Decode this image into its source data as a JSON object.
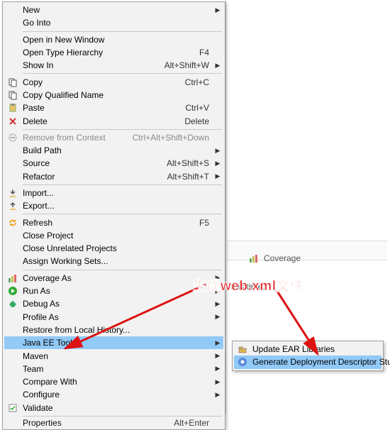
{
  "menu": {
    "items": [
      {
        "label": "New",
        "shortcut": "",
        "sub": true
      },
      {
        "label": "Go Into"
      },
      {
        "sep": true
      },
      {
        "label": "Open in New Window"
      },
      {
        "label": "Open Type Hierarchy",
        "shortcut": "F4"
      },
      {
        "label": "Show In",
        "shortcut": "Alt+Shift+W",
        "sub": true
      },
      {
        "sep": true
      },
      {
        "label": "Copy",
        "shortcut": "Ctrl+C",
        "icon": "copy"
      },
      {
        "label": "Copy Qualified Name",
        "icon": "copyq"
      },
      {
        "label": "Paste",
        "shortcut": "Ctrl+V",
        "icon": "paste"
      },
      {
        "label": "Delete",
        "shortcut": "Delete",
        "icon": "delete"
      },
      {
        "sep": true
      },
      {
        "label": "Remove from Context",
        "shortcut": "Ctrl+Alt+Shift+Down",
        "disabled": true,
        "icon": "remove"
      },
      {
        "label": "Build Path",
        "sub": true
      },
      {
        "label": "Source",
        "shortcut": "Alt+Shift+S",
        "sub": true
      },
      {
        "label": "Refactor",
        "shortcut": "Alt+Shift+T",
        "sub": true
      },
      {
        "sep": true
      },
      {
        "label": "Import...",
        "icon": "import"
      },
      {
        "label": "Export...",
        "icon": "export"
      },
      {
        "sep": true
      },
      {
        "label": "Refresh",
        "shortcut": "F5",
        "icon": "refresh"
      },
      {
        "label": "Close Project"
      },
      {
        "label": "Close Unrelated Projects"
      },
      {
        "label": "Assign Working Sets..."
      },
      {
        "sep": true
      },
      {
        "label": "Coverage As",
        "sub": true,
        "icon": "coverage"
      },
      {
        "label": "Run As",
        "sub": true,
        "icon": "run"
      },
      {
        "label": "Debug As",
        "sub": true,
        "icon": "debug"
      },
      {
        "label": "Profile As",
        "sub": true
      },
      {
        "label": "Restore from Local History..."
      },
      {
        "label": "Java EE Tools",
        "sub": true,
        "highlight": true
      },
      {
        "label": "Maven",
        "sub": true
      },
      {
        "label": "Team",
        "sub": true
      },
      {
        "label": "Compare With",
        "sub": true
      },
      {
        "label": "Configure",
        "sub": true
      },
      {
        "label": "Validate",
        "icon": "validate"
      },
      {
        "sep": true
      },
      {
        "label": "Properties",
        "shortcut": "Alt+Enter",
        "cutoff": true
      }
    ]
  },
  "submenu": {
    "items": [
      {
        "label": "Update EAR Libraries",
        "icon": "update"
      },
      {
        "label": "Generate Deployment Descriptor Stub",
        "icon": "gen",
        "highlight": true
      }
    ]
  },
  "panel": {
    "coverage": "Coverage",
    "time_text": "t this time."
  },
  "annotation": "生成web.xml文件"
}
